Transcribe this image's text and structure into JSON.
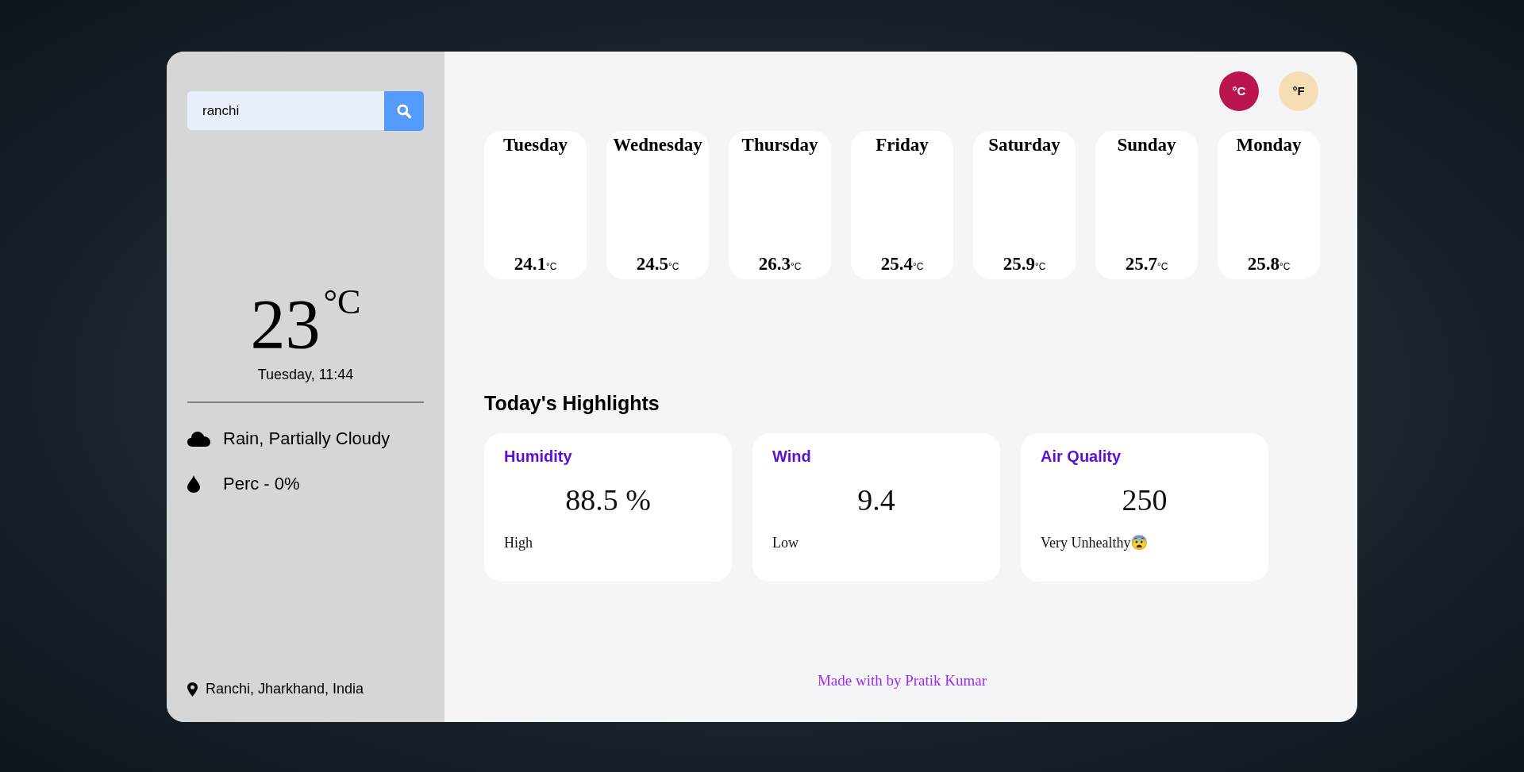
{
  "search": {
    "value": "ranchi"
  },
  "current": {
    "temperature": "23",
    "unit": "°C",
    "datetime": "Tuesday, 11:44",
    "condition": "Rain, Partially Cloudy",
    "precipitation": "Perc - 0%",
    "location": "Ranchi, Jharkhand, India"
  },
  "units": [
    {
      "label": "°C",
      "selected": true
    },
    {
      "label": "°F",
      "selected": false
    }
  ],
  "forecast": [
    {
      "day": "Tuesday",
      "temp": "24.1",
      "unit": "°C"
    },
    {
      "day": "Wednesday",
      "temp": "24.5",
      "unit": "°C"
    },
    {
      "day": "Thursday",
      "temp": "26.3",
      "unit": "°C"
    },
    {
      "day": "Friday",
      "temp": "25.4",
      "unit": "°C"
    },
    {
      "day": "Saturday",
      "temp": "25.9",
      "unit": "°C"
    },
    {
      "day": "Sunday",
      "temp": "25.7",
      "unit": "°C"
    },
    {
      "day": "Monday",
      "temp": "25.8",
      "unit": "°C"
    }
  ],
  "highlights": {
    "title": "Today's Highlights",
    "cards": [
      {
        "title": "Humidity",
        "value": "88.5 %",
        "status": "High"
      },
      {
        "title": "Wind",
        "value": "9.4",
        "status": "Low"
      },
      {
        "title": "Air Quality",
        "value": "250",
        "status": "Very Unhealthy😨"
      }
    ]
  },
  "footer": "Made with by Pratik Kumar"
}
